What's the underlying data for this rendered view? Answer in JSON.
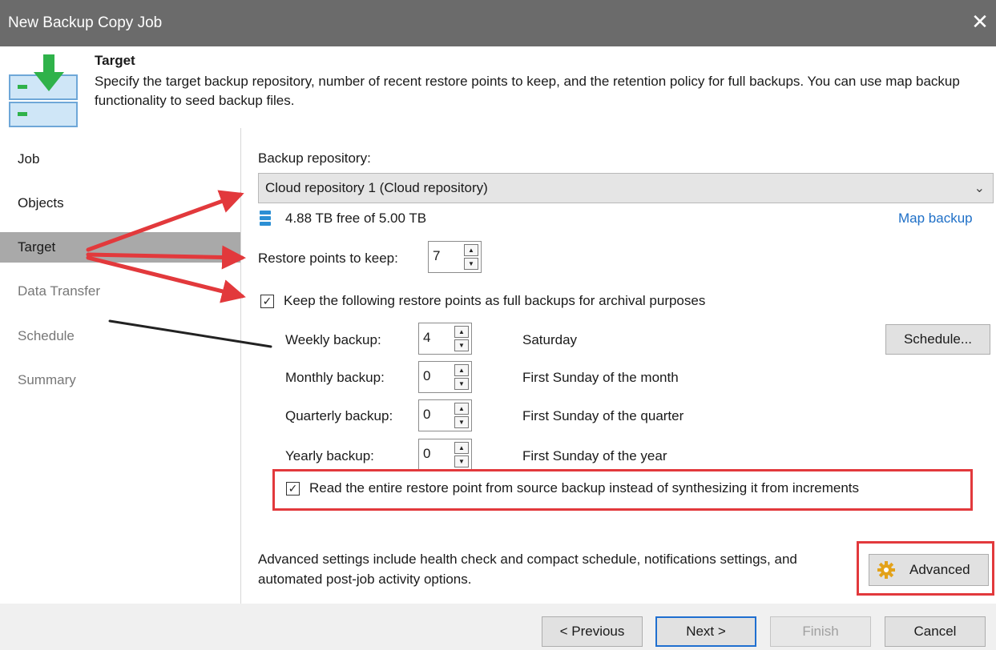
{
  "window": {
    "title": "New Backup Copy Job",
    "close_glyph": "✕"
  },
  "header": {
    "title": "Target",
    "description": "Specify the target backup repository, number of recent restore points to keep, and the retention policy for full backups. You can use map backup functionality to seed backup files."
  },
  "sidebar": {
    "items": [
      {
        "label": "Job",
        "state": "normal"
      },
      {
        "label": "Objects",
        "state": "normal"
      },
      {
        "label": "Target",
        "state": "active"
      },
      {
        "label": "Data Transfer",
        "state": "disabled"
      },
      {
        "label": "Schedule",
        "state": "disabled"
      },
      {
        "label": "Summary",
        "state": "disabled"
      }
    ]
  },
  "repository": {
    "label": "Backup repository:",
    "selected": "Cloud repository 1 (Cloud repository)",
    "free_space": "4.88 TB free of 5.00 TB",
    "map_backup_link": "Map backup"
  },
  "restore_points": {
    "label": "Restore points to keep:",
    "value": "7"
  },
  "archival": {
    "checkbox_label": "Keep the following restore points as full backups for archival purposes",
    "checked": true,
    "rows": [
      {
        "label": "Weekly backup:",
        "value": "4",
        "schedule": "Saturday"
      },
      {
        "label": "Monthly backup:",
        "value": "0",
        "schedule": "First Sunday of the month"
      },
      {
        "label": "Quarterly backup:",
        "value": "0",
        "schedule": "First Sunday of the quarter"
      },
      {
        "label": "Yearly backup:",
        "value": "0",
        "schedule": "First Sunday of the year"
      }
    ],
    "schedule_button": "Schedule..."
  },
  "read_entire": {
    "label": "Read the entire restore point from source backup instead of synthesizing it from increments",
    "checked": true
  },
  "advanced": {
    "description": "Advanced settings include health check and compact schedule, notifications settings, and automated post-job activity options.",
    "button_label": "Advanced"
  },
  "footer": {
    "previous": "< Previous",
    "next": "Next >",
    "finish": "Finish",
    "cancel": "Cancel"
  },
  "colors": {
    "annotation_red": "#e2393c",
    "link_blue": "#1e6fc7",
    "active_nav": "#a9a9a9",
    "titlebar": "#6b6b6b"
  },
  "icons": {
    "header": "backup-copy-target-icon",
    "storage": "database-icon",
    "advanced": "gear-icon",
    "check": "✓",
    "spin_up": "▲",
    "spin_down": "▼",
    "dropdown": "chevron-down-icon"
  }
}
